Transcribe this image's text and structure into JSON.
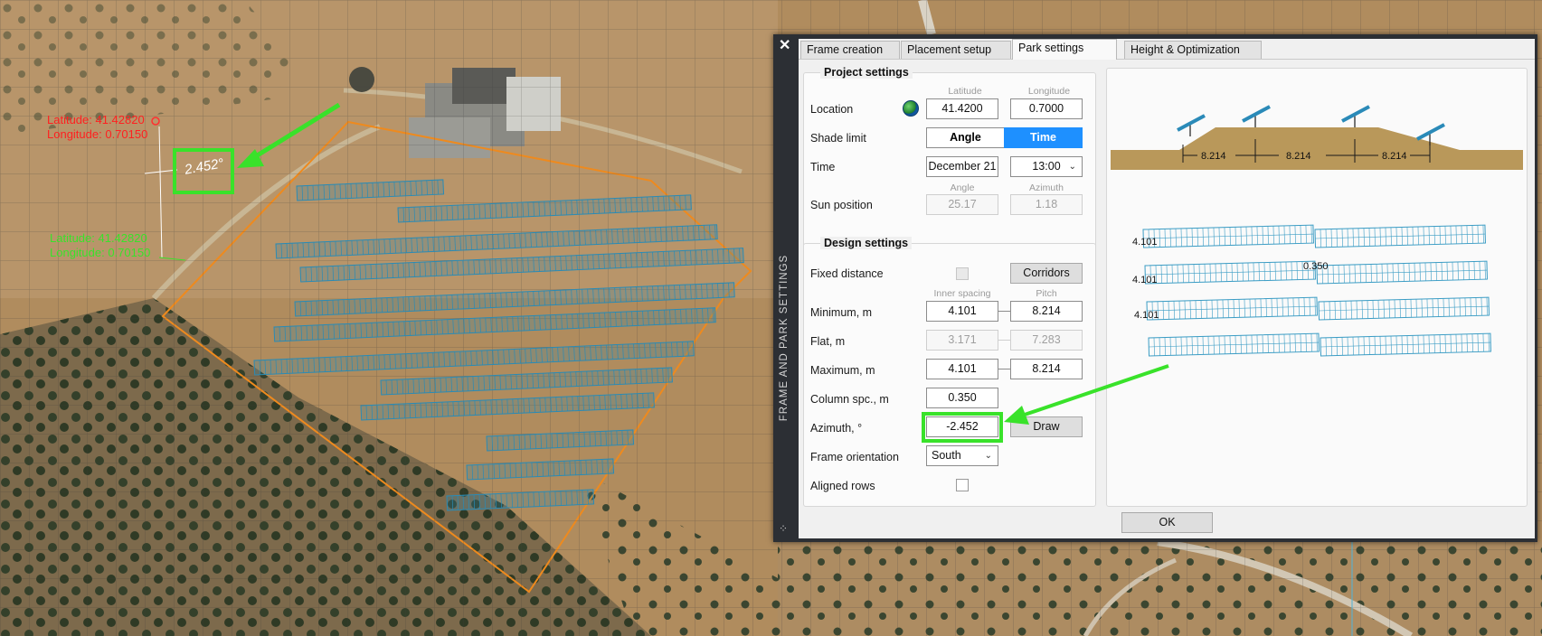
{
  "map": {
    "point_red": {
      "latitude": "Latitude: 41.42820",
      "longitude": "Longitude: 0.70150"
    },
    "point_green": {
      "latitude": "Latitude: 41.42820",
      "longitude": "Longitude: 0.70150"
    },
    "angle_label": "2.452°",
    "highlight_color": "#39e22a"
  },
  "dialog": {
    "close_icon": "close-icon",
    "side_title": "FRAME AND PARK SETTINGS",
    "tabs": [
      {
        "label": "Frame creation",
        "active": false
      },
      {
        "label": "Placement setup",
        "active": false
      },
      {
        "label": "Park settings",
        "active": true
      },
      {
        "label": "Height & Optimization",
        "active": false
      }
    ],
    "project": {
      "title": "Project settings",
      "headers": {
        "lat": "Latitude",
        "lon": "Longitude",
        "angle": "Angle",
        "azimuth": "Azimuth"
      },
      "location": {
        "label": "Location",
        "latitude": "41.4200",
        "longitude": "0.7000",
        "icon": "globe-icon"
      },
      "shade_limit": {
        "label": "Shade limit",
        "option_angle": "Angle",
        "option_time": "Time",
        "selected": "Time"
      },
      "time": {
        "label": "Time",
        "date": "December 21",
        "hour": "13:00"
      },
      "sun_position": {
        "label": "Sun position",
        "angle": "25.17",
        "azimuth": "1.18"
      }
    },
    "design": {
      "title": "Design settings",
      "headers": {
        "inner": "Inner spacing",
        "pitch": "Pitch"
      },
      "fixed_distance": {
        "label": "Fixed distance",
        "checked": false,
        "corridors_label": "Corridors"
      },
      "minimum": {
        "label": "Minimum, m",
        "inner": "4.101",
        "pitch": "8.214"
      },
      "flat": {
        "label": "Flat, m",
        "inner": "3.171",
        "pitch": "7.283"
      },
      "maximum": {
        "label": "Maximum, m",
        "inner": "4.101",
        "pitch": "8.214"
      },
      "column_spacing": {
        "label": "Column spc., m",
        "value": "0.350"
      },
      "azimuth": {
        "label": "Azimuth, °",
        "value": "-2.452",
        "draw_label": "Draw"
      },
      "frame_orientation": {
        "label": "Frame orientation",
        "value": "South"
      },
      "aligned_rows": {
        "label": "Aligned rows",
        "checked": false
      }
    },
    "preview": {
      "pitch_labels": [
        "8.214",
        "8.214",
        "8.214"
      ],
      "inner_labels": [
        "4.101",
        "4.101",
        "4.101"
      ],
      "column_label": "0.350"
    },
    "ok_label": "OK",
    "accent_color": "#1e90ff"
  }
}
